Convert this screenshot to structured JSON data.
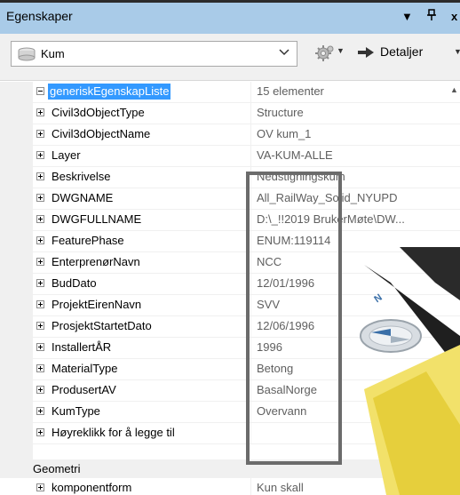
{
  "panel": {
    "title": "Egenskaper",
    "pin_glyph": "▾",
    "pin_icon": "𝟰",
    "close_glyph": "x"
  },
  "toolbar": {
    "object_select_value": "Kum",
    "details_label": "Detaljer"
  },
  "grid": {
    "root": {
      "name": "generiskEgenskapListe",
      "value": "15 elementer"
    },
    "properties": [
      {
        "name": "Civil3dObjectType",
        "value": "Structure"
      },
      {
        "name": "Civil3dObjectName",
        "value": "OV kum_1"
      },
      {
        "name": "Layer",
        "value": "VA-KUM-ALLE"
      },
      {
        "name": "Beskrivelse",
        "value": "Nedstigningskum"
      },
      {
        "name": "DWGNAME",
        "value": "All_RailWay_Solid_NYUPD"
      },
      {
        "name": "DWGFULLNAME",
        "value": "D:\\_!!2019 BrukerMøte\\DW..."
      },
      {
        "name": "FeaturePhase",
        "value": "ENUM:119114"
      },
      {
        "name": "EnterprenørNavn",
        "value": "NCC"
      },
      {
        "name": "BudDato",
        "value": "12/01/1996"
      },
      {
        "name": "ProjektEirenNavn",
        "value": "SVV"
      },
      {
        "name": "ProsjektStartetDato",
        "value": "12/06/1996"
      },
      {
        "name": "InstallertÅR",
        "value": "1996"
      },
      {
        "name": "MaterialType",
        "value": "Betong"
      },
      {
        "name": "ProdusertAV",
        "value": "BasalNorge"
      },
      {
        "name": "KumType",
        "value": "Overvann"
      },
      {
        "name": "Høyreklikk for å legge til",
        "value": ""
      }
    ],
    "category": {
      "name": "Geometri"
    },
    "category_items": [
      {
        "name": "komponentform",
        "value": "Kun skall"
      }
    ]
  },
  "viewport": {
    "compass_label": "N"
  },
  "colors": {
    "title_bar": "#a9cbe8",
    "selection": "#3399ff",
    "highlight_box": "#6b6b6b",
    "value_text": "#5f5f5f"
  }
}
